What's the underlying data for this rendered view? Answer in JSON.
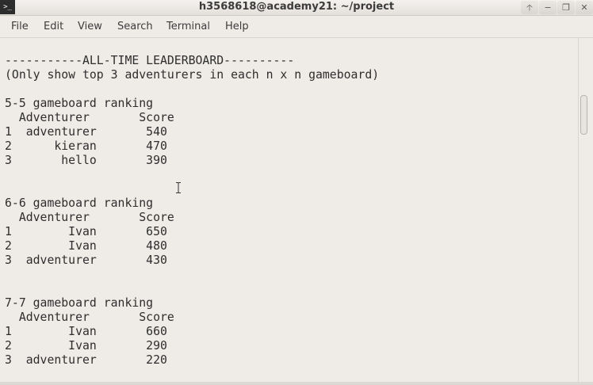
{
  "window": {
    "title": "h3568618@academy21: ~/project",
    "app_icon_label": ">_",
    "buttons": [
      {
        "icon": "up-arrow-icon",
        "glyph": "🡡"
      },
      {
        "icon": "minimize-icon",
        "glyph": "−"
      },
      {
        "icon": "maximize-icon",
        "glyph": "❐"
      },
      {
        "icon": "close-icon",
        "glyph": "✕"
      }
    ]
  },
  "menu": [
    "File",
    "Edit",
    "View",
    "Search",
    "Terminal",
    "Help"
  ],
  "terminal": {
    "lines": [
      "-----------ALL-TIME LEADERBOARD----------",
      "(Only show top 3 adventurers in each n x n gameboard)",
      "",
      "5-5 gameboard ranking",
      "  Adventurer       Score",
      "1  adventurer       540",
      "2      kieran       470",
      "3       hello       390",
      "",
      "",
      "6-6 gameboard ranking",
      "  Adventurer       Score",
      "1        Ivan       650",
      "2        Ivan       480",
      "3  adventurer       430",
      "",
      "",
      "7-7 gameboard ranking",
      "  Adventurer       Score",
      "1        Ivan       660",
      "2        Ivan       290",
      "3  adventurer       220"
    ]
  },
  "colors": {
    "background": "#efebe7",
    "text": "#2e2e2e"
  }
}
